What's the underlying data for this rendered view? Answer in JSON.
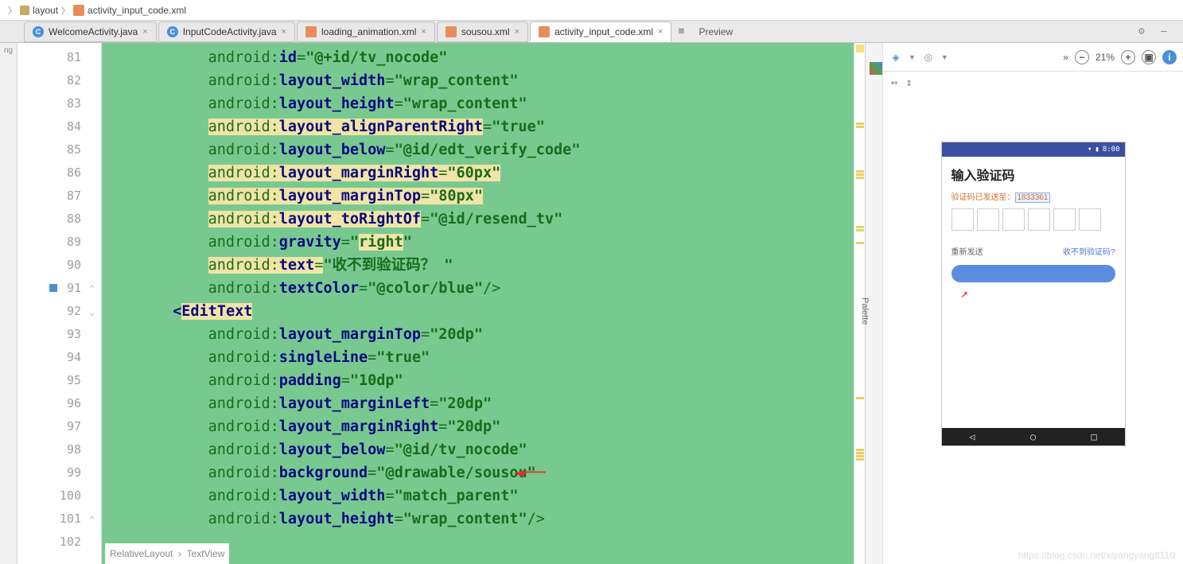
{
  "breadcrumb": {
    "layout": "layout",
    "file": "activity_input_code.xml"
  },
  "tabs": [
    {
      "label": "WelcomeActivity.java",
      "type": "java"
    },
    {
      "label": "InputCodeActivity.java",
      "type": "java"
    },
    {
      "label": "loading_animation.xml",
      "type": "xml"
    },
    {
      "label": "sousou.xml",
      "type": "xml"
    },
    {
      "label": "activity_input_code.xml",
      "type": "xml",
      "active": true
    }
  ],
  "preview_label": "Preview",
  "zoom": "21%",
  "line_numbers": [
    "81",
    "82",
    "83",
    "84",
    "85",
    "86",
    "87",
    "88",
    "89",
    "90",
    "91",
    "92",
    "93",
    "94",
    "95",
    "96",
    "97",
    "98",
    "99",
    "100",
    "101",
    "102"
  ],
  "code": {
    "l81": {
      "pre": "            ",
      "ns": "android:",
      "attr": "id",
      "val": "@+id/tv_nocode"
    },
    "l82": {
      "pre": "            ",
      "ns": "android:",
      "attr": "layout_width",
      "val": "wrap_content"
    },
    "l83": {
      "pre": "            ",
      "ns": "android:",
      "attr": "layout_height",
      "val": "wrap_content"
    },
    "l84": {
      "pre": "            ",
      "ns": "android:",
      "attr": "layout_alignParentRight",
      "val": "true",
      "hl": true
    },
    "l85": {
      "pre": "            ",
      "ns": "android:",
      "attr": "layout_below",
      "val": "@id/edt_verify_code"
    },
    "l86": {
      "pre": "            ",
      "ns": "android:",
      "attr": "layout_marginRight",
      "val": "60px",
      "hl": true
    },
    "l87": {
      "pre": "            ",
      "ns": "android:",
      "attr": "layout_marginTop",
      "val": "80px",
      "hl": true
    },
    "l88": {
      "pre": "            ",
      "ns": "android:",
      "attr": "layout_toRightOf",
      "val": "@id/resend_tv",
      "hl": true,
      "hl_attr_only": true
    },
    "l89": {
      "pre": "            ",
      "ns": "android:",
      "attr": "gravity",
      "val": "right",
      "hl_val": true
    },
    "l90": {
      "pre": "            ",
      "ns": "android:",
      "attr": "text",
      "val": "收不到验证码？ ",
      "hl_prefix": true
    },
    "l91": {
      "pre": "            ",
      "ns": "android:",
      "attr": "textColor",
      "val": "@color/blue",
      "close": "/>"
    },
    "l92": {
      "pre": "        ",
      "tag": "EditText",
      "hl": true
    },
    "l93": {
      "pre": "            ",
      "ns": "android:",
      "attr": "layout_marginTop",
      "val": "20dp"
    },
    "l94": {
      "pre": "            ",
      "ns": "android:",
      "attr": "singleLine",
      "val": "true"
    },
    "l95": {
      "pre": "            ",
      "ns": "android:",
      "attr": "padding",
      "val": "10dp"
    },
    "l96": {
      "pre": "            ",
      "ns": "android:",
      "attr": "layout_marginLeft",
      "val": "20dp"
    },
    "l97": {
      "pre": "            ",
      "ns": "android:",
      "attr": "layout_marginRight",
      "val": "20dp"
    },
    "l98": {
      "pre": "            ",
      "ns": "android:",
      "attr": "layout_below",
      "val": "@id/tv_nocode"
    },
    "l99": {
      "pre": "            ",
      "ns": "android:",
      "attr": "background",
      "val": "@drawable/sousou"
    },
    "l100": {
      "pre": "            ",
      "ns": "android:",
      "attr": "layout_width",
      "val": "match_parent"
    },
    "l101": {
      "pre": "            ",
      "ns": "android:",
      "attr": "layout_height",
      "val": "wrap_content",
      "close": "/>"
    }
  },
  "bottom_crumb": {
    "a": "RelativeLayout",
    "b": "TextView"
  },
  "phone": {
    "time": "8:00",
    "title": "输入验证码",
    "sent_label": "验证码已发送至：",
    "sent_num": "1833361",
    "resend": "重新发送",
    "nocode": "收不到验证码?"
  },
  "palette_label": "Palette",
  "watermark": "https://blog.csdn.net/xiyangyang8110"
}
